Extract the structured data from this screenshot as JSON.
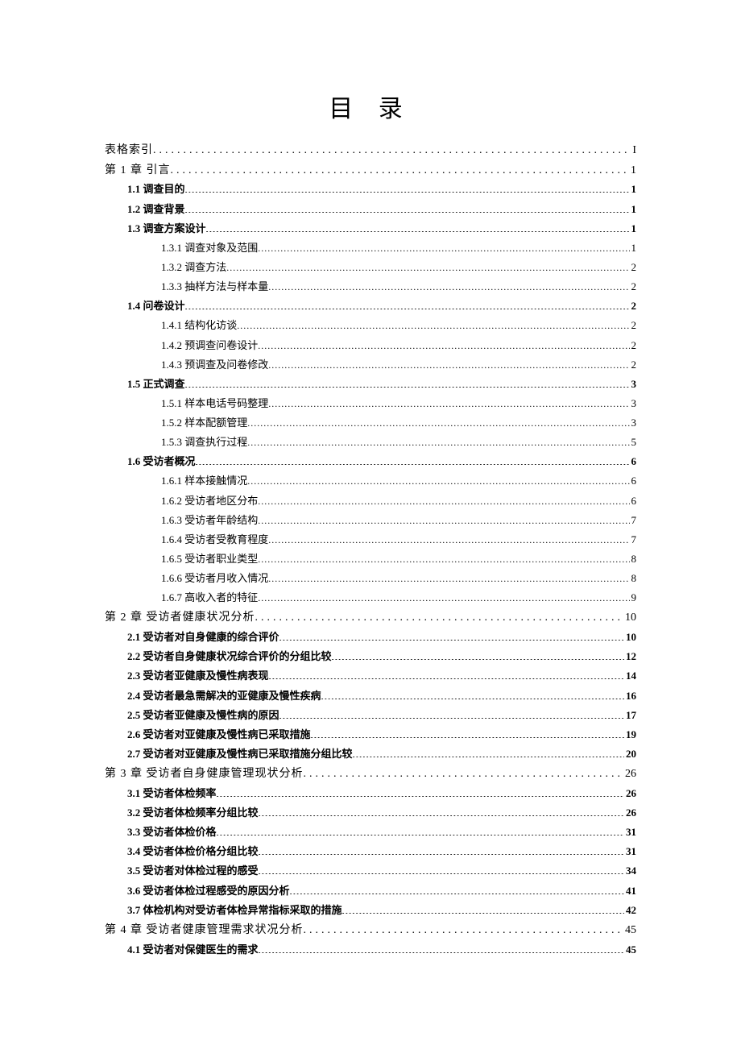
{
  "title": "目 录",
  "entries": [
    {
      "level": 1,
      "label": "表格索引",
      "page": "I"
    },
    {
      "level": 1,
      "label": "第 1 章 引言",
      "page": "1"
    },
    {
      "level": 2,
      "label": "1.1  调查目的",
      "page": "1"
    },
    {
      "level": 2,
      "label": "1.2  调查背景",
      "page": "1"
    },
    {
      "level": 2,
      "label": "1.3  调查方案设计",
      "page": "1"
    },
    {
      "level": 3,
      "label": "1.3.1  调查对象及范围",
      "page": "1"
    },
    {
      "level": 3,
      "label": "1.3.2  调查方法",
      "page": "2"
    },
    {
      "level": 3,
      "label": "1.3.3 抽样方法与样本量",
      "page": "2"
    },
    {
      "level": 2,
      "label": "1.4  问卷设计",
      "page": "2"
    },
    {
      "level": 3,
      "label": "1.4.1  结构化访谈",
      "page": "2"
    },
    {
      "level": 3,
      "label": "1.4.2  预调查问卷设计",
      "page": "2"
    },
    {
      "level": 3,
      "label": "1.4.3  预调查及问卷修改",
      "page": "2"
    },
    {
      "level": 2,
      "label": "1.5  正式调查",
      "page": "3"
    },
    {
      "level": 3,
      "label": "1.5.1  样本电话号码整理",
      "page": "3"
    },
    {
      "level": 3,
      "label": "1.5.2  样本配额管理",
      "page": "3"
    },
    {
      "level": 3,
      "label": "1.5.3  调查执行过程",
      "page": "5"
    },
    {
      "level": 2,
      "label": "1.6  受访者概况",
      "page": "6"
    },
    {
      "level": 3,
      "label": "1.6.1  样本接触情况",
      "page": "6"
    },
    {
      "level": 3,
      "label": "1.6.2  受访者地区分布",
      "page": "6"
    },
    {
      "level": 3,
      "label": "1.6.3  受访者年龄结构",
      "page": "7"
    },
    {
      "level": 3,
      "label": "1.6.4 受访者受教育程度",
      "page": "7"
    },
    {
      "level": 3,
      "label": "1.6.5  受访者职业类型",
      "page": "8"
    },
    {
      "level": 3,
      "label": "1.6.6  受访者月收入情况",
      "page": "8"
    },
    {
      "level": 3,
      "label": "1.6.7 高收入者的特征",
      "page": "9"
    },
    {
      "level": 1,
      "label": "第 2 章  受访者健康状况分析",
      "page": "10"
    },
    {
      "level": 2,
      "label": "2.1 受访者对自身健康的综合评价",
      "page": "10"
    },
    {
      "level": 2,
      "label": "2.2 受访者自身健康状况综合评价的分组比较",
      "page": "12"
    },
    {
      "level": 2,
      "label": "2.3 受访者亚健康及慢性病表现",
      "page": "14"
    },
    {
      "level": 2,
      "label": "2.4 受访者最急需解决的亚健康及慢性疾病",
      "page": "16"
    },
    {
      "level": 2,
      "label": "2.5 受访者亚健康及慢性病的原因",
      "page": "17"
    },
    {
      "level": 2,
      "label": "2.6 受访者对亚健康及慢性病已采取措施",
      "page": "19"
    },
    {
      "level": 2,
      "label": "2.7 受访者对亚健康及慢性病已采取措施分组比较",
      "page": "20"
    },
    {
      "level": 1,
      "label": "第 3 章  受访者自身健康管理现状分析",
      "page": "26"
    },
    {
      "level": 2,
      "label": "3.1 受访者体检频率",
      "page": "26"
    },
    {
      "level": 2,
      "label": "3.2 受访者体检频率分组比较",
      "page": "26"
    },
    {
      "level": 2,
      "label": "3.3 受访者体检价格",
      "page": "31"
    },
    {
      "level": 2,
      "label": "3.4 受访者体检价格分组比较",
      "page": "31"
    },
    {
      "level": 2,
      "label": "3.5 受访者对体检过程的感受",
      "page": "34"
    },
    {
      "level": 2,
      "label": "3.6 受访者体检过程感受的原因分析",
      "page": "41"
    },
    {
      "level": 2,
      "label": "3.7 体检机构对受访者体检异常指标采取的措施",
      "page": "42"
    },
    {
      "level": 1,
      "label": "第 4 章  受访者健康管理需求状况分析",
      "page": "45"
    },
    {
      "level": 2,
      "label": "4.1 受访者对保健医生的需求",
      "page": "45"
    }
  ]
}
